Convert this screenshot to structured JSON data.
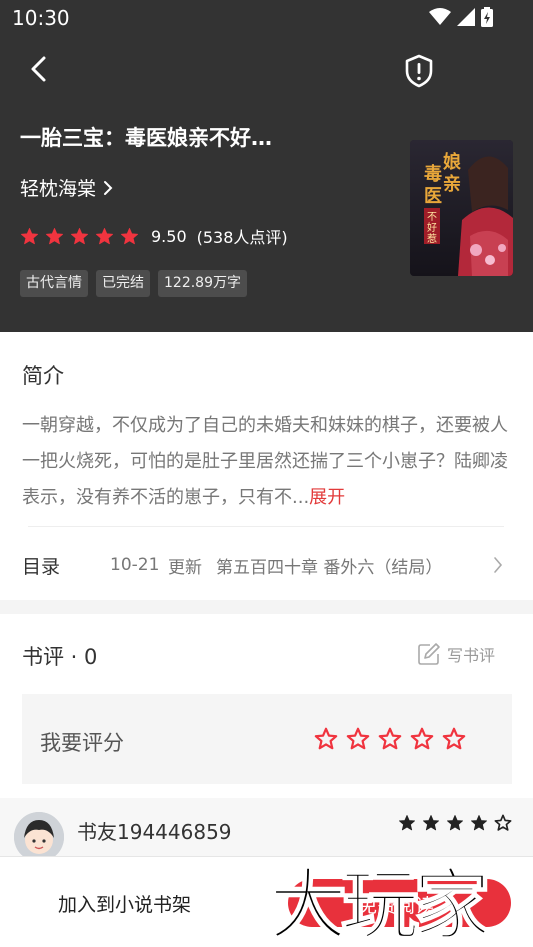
{
  "status": {
    "time": "10:30"
  },
  "book": {
    "title": "一胎三宝：毒医娘亲不好…",
    "author": "轻枕海棠",
    "score": "9.50",
    "rating_count": "(538人点评)",
    "rating_stars": 5,
    "tags": [
      "古代言情",
      "已完结",
      "122.89万字"
    ],
    "cover_title_chars": [
      "毒",
      "娘",
      "医",
      "亲",
      "不",
      "好",
      "惹"
    ]
  },
  "intro": {
    "label": "简介",
    "text": "一朝穿越，不仅成为了自己的未婚夫和妹妹的棋子，还要被人一把火烧死，可怕的是肚子里居然还揣了三个小崽子？陆卿凌表示，没有养不活的崽子，只有不...",
    "expand": "展开"
  },
  "toc": {
    "label": "目录",
    "date": "10-21",
    "updated": "更新",
    "latest_chapter": "第五百四十章 番外六（结局）"
  },
  "reviews": {
    "title": "书评 · 0",
    "write_label": "写书评",
    "rate_label": "我要评分",
    "rate_stars": 5,
    "first_review": {
      "user": "书友194446859",
      "stars_filled": 4,
      "stars_total": 5
    }
  },
  "bottom": {
    "add_shelf": "加入到小说书架",
    "read_label": "免费阅读"
  },
  "watermark": {
    "text": "大玩家"
  },
  "colors": {
    "hero_bg": "#333333",
    "accent_red": "#e8313c",
    "star_red": "#f0343f",
    "expand_red": "#e23a3a"
  },
  "icons": {
    "back": "chevron-left-icon",
    "report": "shield-alert-icon",
    "write": "edit-icon",
    "toc_arrow": "chevron-right-icon"
  }
}
